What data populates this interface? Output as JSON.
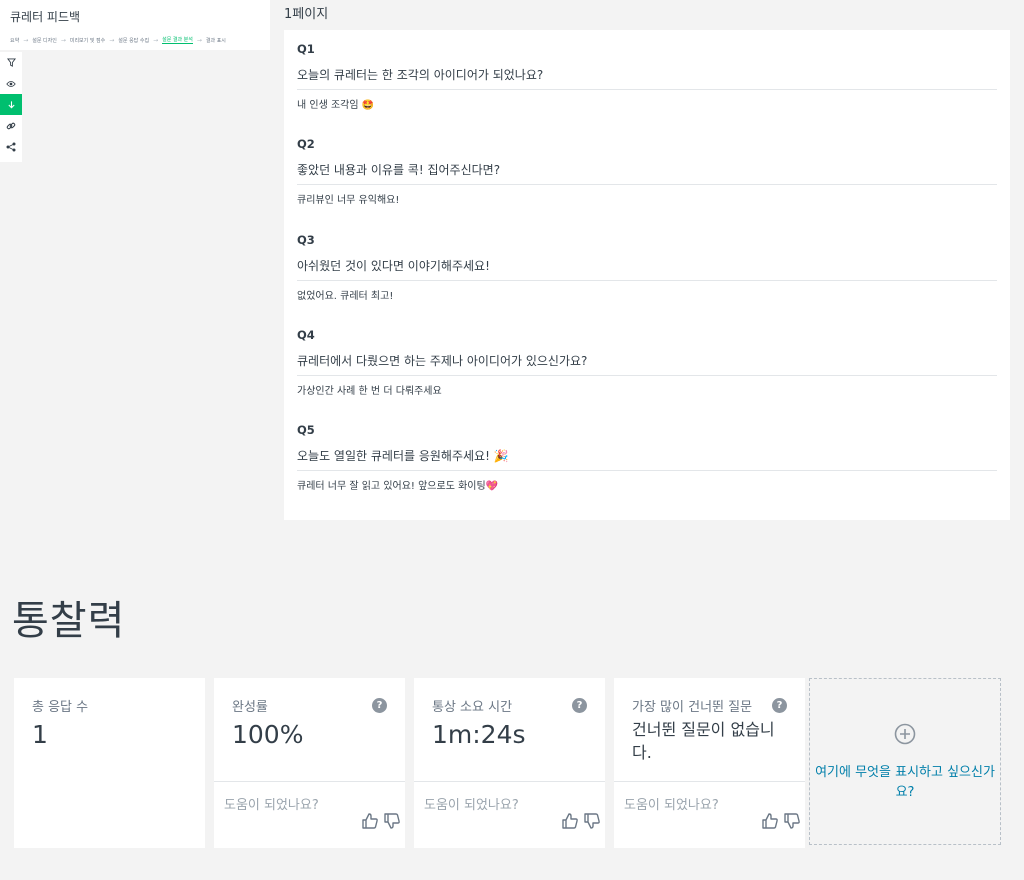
{
  "app": {
    "title": "큐레터 피드백",
    "steps": [
      {
        "label": "요약"
      },
      {
        "label": "설문 디자인"
      },
      {
        "label": "미리보기 및 점수"
      },
      {
        "label": "설문 응답 수집"
      },
      {
        "label": "설문 결과 분석"
      },
      {
        "label": "결과 표시"
      }
    ],
    "active_step": "설문 결과 분석",
    "tools": [
      "filter-icon",
      "eye-icon",
      "download-icon",
      "link-icon",
      "share-icon"
    ]
  },
  "page_label": "1페이지",
  "questions": [
    {
      "num": "Q1",
      "text": "오늘의 큐레터는 한 조각의 아이디어가 되었나요?",
      "answer": "내 인생 조각임 🤩"
    },
    {
      "num": "Q2",
      "text": "좋았던 내용과 이유를 콕! 집어주신다면?",
      "answer": "큐리뷰인 너무 유익해요!"
    },
    {
      "num": "Q3",
      "text": "아쉬웠던 것이 있다면 이야기해주세요!",
      "answer": "없었어요. 큐레터 최고!"
    },
    {
      "num": "Q4",
      "text": "큐레터에서 다뤘으면 하는 주제나 아이디어가 있으신가요?",
      "answer": "가상인간 사례 한 번 더 다뤄주세요"
    },
    {
      "num": "Q5",
      "text": "오늘도 열일한 큐레터를 응원해주세요! 🎉",
      "answer": "큐레터 너무 잘 읽고 있어요! 앞으로도 화이팅💖"
    }
  ],
  "section_title": "통찰력",
  "stats": [
    {
      "title": "총 응답 수",
      "value": "1",
      "has_help": false,
      "helpful": ""
    },
    {
      "title": "완성률",
      "value": "100%",
      "has_help": true,
      "helpful": "도움이 되었나요?"
    },
    {
      "title": "통상 소요 시간",
      "value": "1m:24s",
      "has_help": true,
      "helpful": "도움이 되었나요?"
    },
    {
      "title": "가장 많이 건너뛴 질문",
      "value": "건너뛴 질문이 없습니다.",
      "has_help": true,
      "helpful": "도움이 되었나요?"
    }
  ],
  "help_glyph": "?",
  "add_card": {
    "text": "여기에 무엇을 표시하고 싶으신가요?"
  },
  "colors": {
    "accent": "#00bf6f",
    "link": "#007faa",
    "text": "#333e48",
    "muted": "#9aa4ad"
  }
}
